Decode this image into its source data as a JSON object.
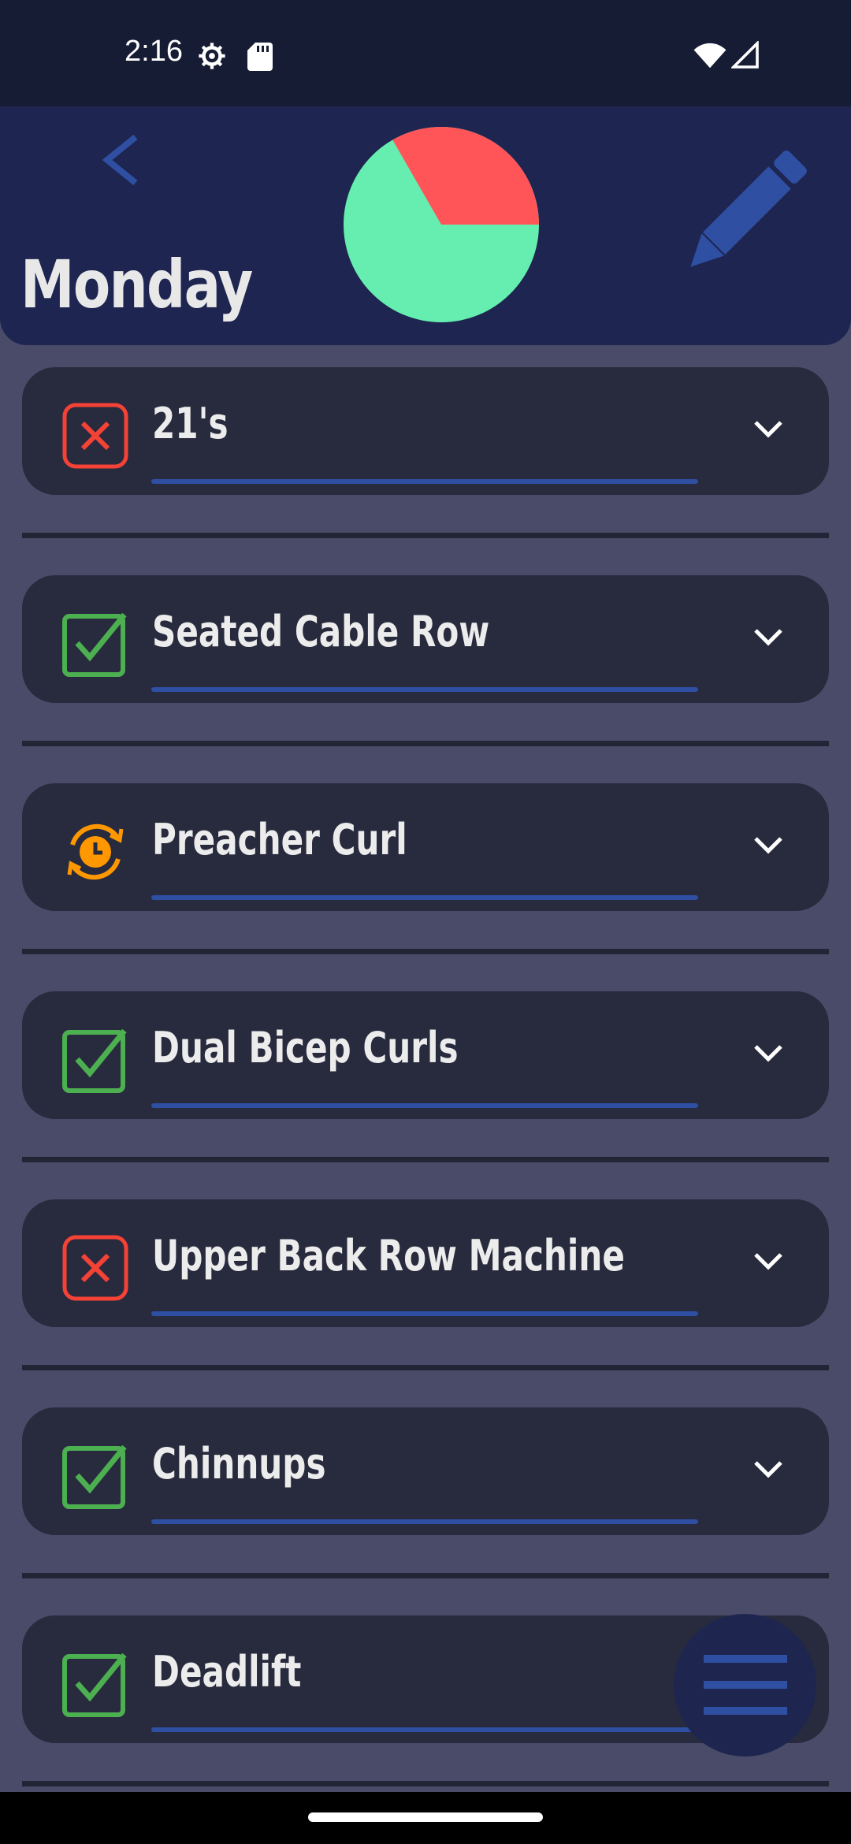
{
  "status_bar": {
    "time": "2:16",
    "icons": [
      "gear-icon",
      "sd-card-icon",
      "wifi-icon",
      "cellular-signal-icon"
    ]
  },
  "header": {
    "title": "Monday",
    "back_icon": "chevron-left-icon",
    "edit_icon": "pencil-icon",
    "progress_pie": {
      "completed_color": "#66eeb0",
      "remaining_color": "#ff5558",
      "completed_fraction": 0.667,
      "remaining_fraction": 0.333
    }
  },
  "colors": {
    "background": "#4a4b68",
    "card": "#282a3d",
    "header": "#1d2550",
    "accent_blue": "#2f4fa3",
    "done_green": "#4caf50",
    "skipped_red": "#f44336",
    "pending_orange": "#ff9800"
  },
  "exercises": [
    {
      "name": "21's",
      "status": "skipped",
      "status_icon": "x-box-icon"
    },
    {
      "name": "Seated Cable Row",
      "status": "done",
      "status_icon": "check-box-icon"
    },
    {
      "name": "Preacher Curl",
      "status": "pending",
      "status_icon": "timer-refresh-icon"
    },
    {
      "name": "Dual Bicep Curls",
      "status": "done",
      "status_icon": "check-box-icon"
    },
    {
      "name": "Upper Back Row Machine",
      "status": "skipped",
      "status_icon": "x-box-icon"
    },
    {
      "name": "Chinnups",
      "status": "done",
      "status_icon": "check-box-icon"
    },
    {
      "name": "Deadlift",
      "status": "done",
      "status_icon": "check-box-icon"
    }
  ],
  "fab": {
    "icon": "menu-icon"
  }
}
